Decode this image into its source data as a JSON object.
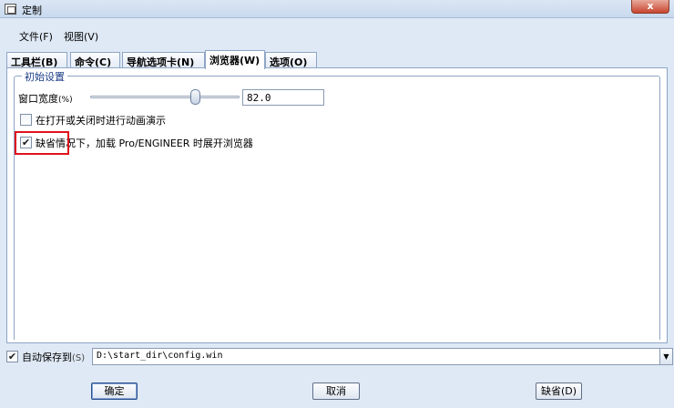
{
  "window": {
    "title": "定制",
    "close_label": "x"
  },
  "menu": {
    "items": [
      "文件(F)",
      "视图(V)"
    ]
  },
  "tabs": [
    {
      "label": "工具栏(B)",
      "active": false
    },
    {
      "label": "命令(C)",
      "active": false
    },
    {
      "label": "导航选项卡(N)",
      "active": false
    },
    {
      "label": "浏览器(W)",
      "active": true
    },
    {
      "label": "选项(O)",
      "active": false
    }
  ],
  "group": {
    "title": "初始设置",
    "width_label": "窗口宽度",
    "width_unit": "(%)",
    "width_value": "82.0",
    "width_slider_level": 0.82,
    "animate_label": "在打开或关闭时进行动画演示",
    "animate_checked": false,
    "expand_label": "缺省情况下，加载 Pro/ENGINEER 时展开浏览器",
    "expand_checked": true,
    "checkmark": "✔"
  },
  "autosave": {
    "label": "自动保存到",
    "shortcut": "(S)",
    "checked": true,
    "path": "D:\\start_dir\\config.win",
    "dropdown_icon": "▼"
  },
  "buttons": {
    "ok": "确定",
    "cancel": "取消",
    "default": "缺省(D)"
  },
  "colors": {
    "highlight": "#e0121d",
    "group_title": "#1b3d86",
    "background": "#dfe9f5"
  }
}
